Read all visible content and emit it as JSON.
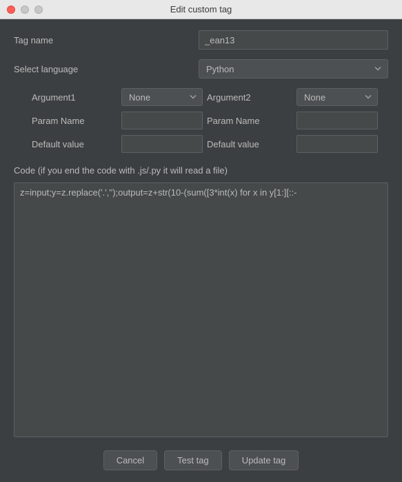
{
  "window": {
    "title": "Edit custom tag"
  },
  "form": {
    "tag_name_label": "Tag name",
    "tag_name_value": "_ean13",
    "language_label": "Select language",
    "language_value": "Python",
    "argument1": {
      "label": "Argument1",
      "type_value": "None",
      "param_label": "Param Name",
      "param_value": "",
      "default_label": "Default value",
      "default_value": ""
    },
    "argument2": {
      "label": "Argument2",
      "type_value": "None",
      "param_label": "Param Name",
      "param_value": "",
      "default_label": "Default value",
      "default_value": ""
    },
    "code_label": "Code (if you end the code with .js/.py it will read a file)",
    "code_value": "z=input;y=z.replace('.','');output=z+str(10-(sum([3*int(x) for x in y[1:][::-"
  },
  "buttons": {
    "cancel": "Cancel",
    "test": "Test tag",
    "update": "Update tag"
  }
}
